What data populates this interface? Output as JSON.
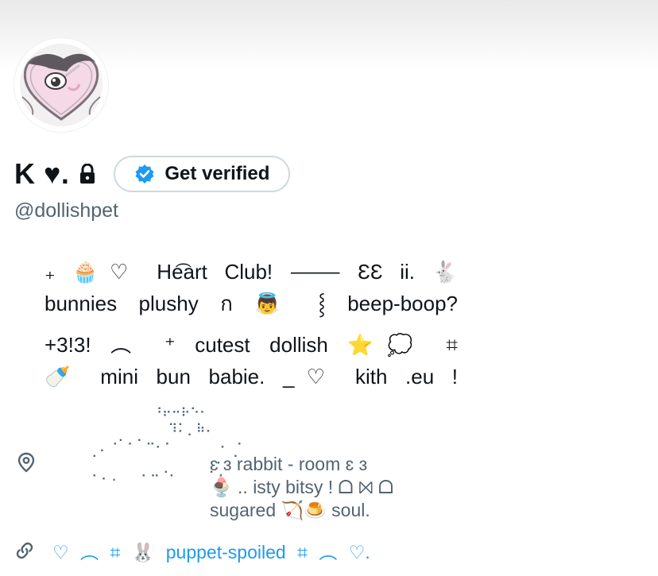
{
  "profile": {
    "display_name": "K ♥︎.",
    "handle": "@dollishpet",
    "verify_button_label": "Get verified",
    "protected": true
  },
  "bio": {
    "lines": [
      "₊  🧁♡  He͡art  Club!  ⸻  ƐƐ  ii.  🐇",
      "bunnies  plushy  ก  👼  ⸾  beep-boop?",
      "+3!3!  ︵  ⁺  cutest  dollish  ⭐💭  ⌗",
      "🍼  mini  bun  babie.  _♡  kith  .eu !"
    ]
  },
  "location": {
    "art": "          ⠘⠖⠒⠗⠑⠂\n            ⠹⠅⡀⠷⠄⠀\n   ⡀⠐⠁⠂⠁⠒⠄⠂      ⠄ ⠂\n  ⠁               ⠄ ⠁\n  ⠂⠄.   ⠂⠒⠈⠂    ⠁⠂",
    "lines": [
      "ɛ ɜ rabbit - room  ɛ ɜ",
      "🍨 .. isty bitsy ! ᗝ ⨝ ᗝ",
      "sugared  🏹🍮  soul."
    ]
  },
  "link": {
    "text": "♡ ︵ ⌗ 🐰 puppet-spoiled ⌗ ︵ ♡."
  },
  "colors": {
    "link": "#1d9bf0",
    "secondary_text": "#536471",
    "verified_badge": "#1d9bf0"
  },
  "icons": {
    "lock": "lock-icon",
    "verified": "verified-badge-icon",
    "location": "location-pin-icon",
    "link": "link-icon"
  }
}
